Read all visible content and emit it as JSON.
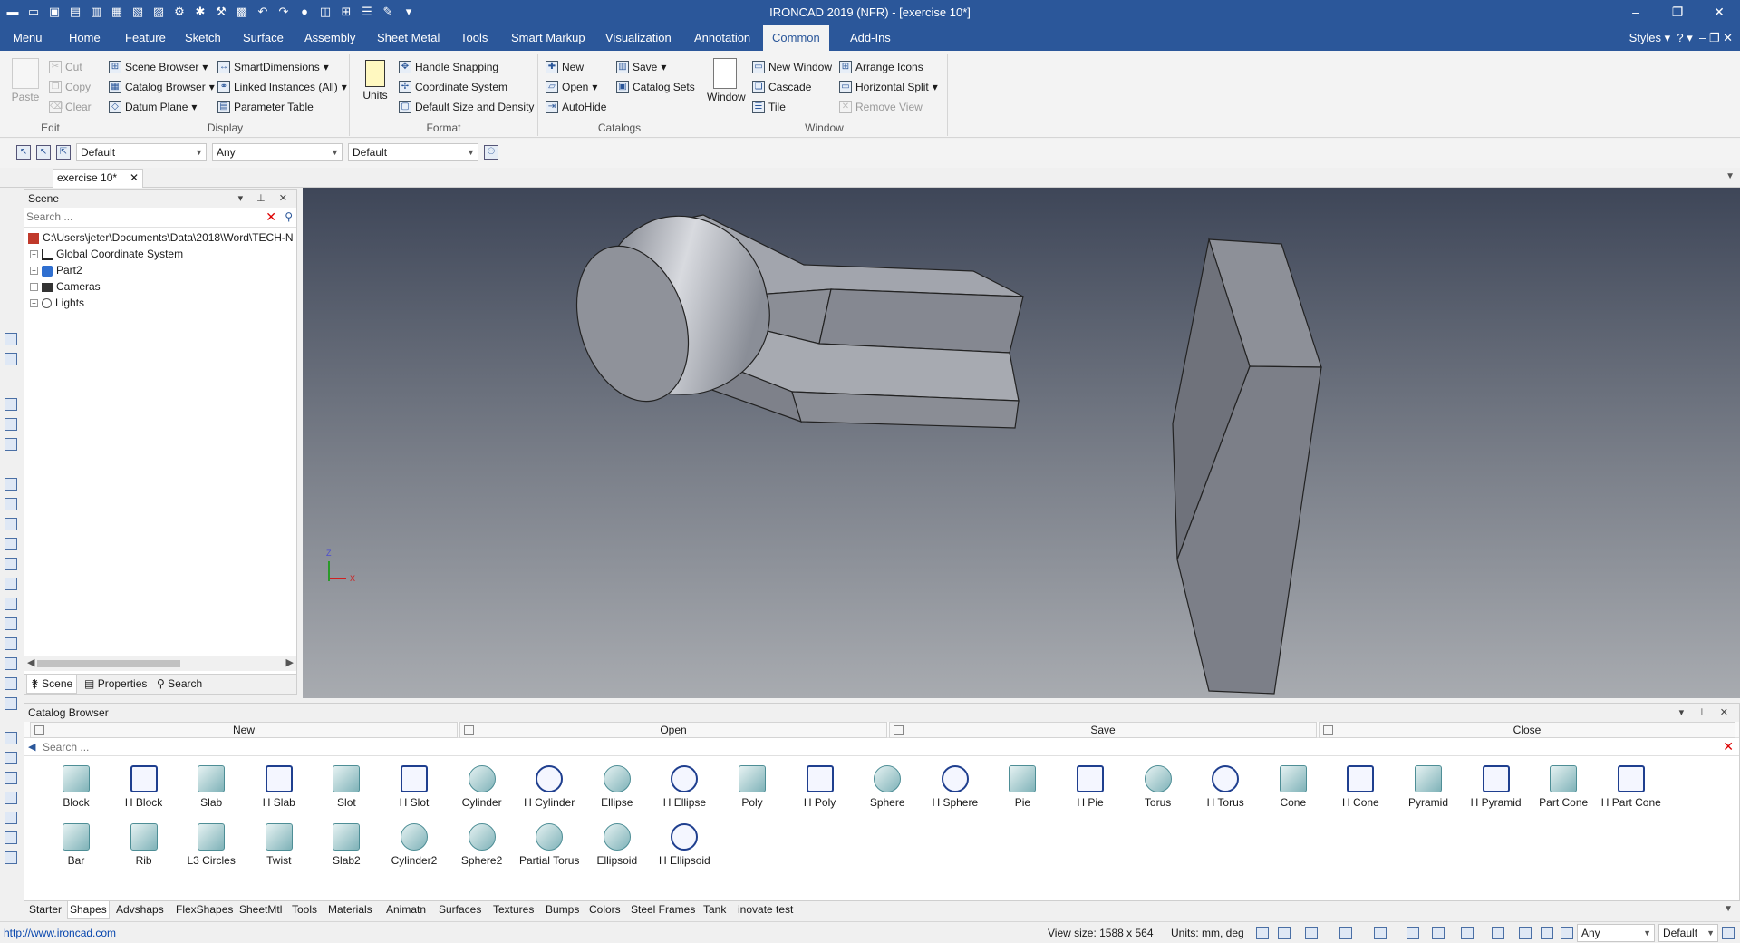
{
  "window": {
    "title": "IRONCAD 2019 (NFR) - [exercise 10*]",
    "controls": [
      "–",
      "❐",
      "✕"
    ]
  },
  "ribbon_tabs": [
    "Menu",
    "Home",
    "Feature",
    "Sketch",
    "Surface",
    "Assembly",
    "Sheet Metal",
    "Tools",
    "Smart Markup",
    "Visualization",
    "Annotation",
    "Common",
    "Add-Ins"
  ],
  "active_tab": "Common",
  "styles_label": "Styles",
  "ribbon": {
    "edit": {
      "label": "Edit",
      "paste": "Paste",
      "cut": "Cut",
      "copy": "Copy",
      "clear": "Clear"
    },
    "display": {
      "label": "Display",
      "scene_browser": "Scene Browser",
      "catalog_browser": "Catalog Browser",
      "datum_plane": "Datum Plane",
      "smart_dimensions": "SmartDimensions",
      "linked_instances": "Linked Instances (All)",
      "parameter_table": "Parameter Table"
    },
    "format": {
      "label": "Format",
      "units": "Units",
      "handle_snapping": "Handle Snapping",
      "coordinate_system": "Coordinate System",
      "default_size": "Default Size and Density"
    },
    "catalogs": {
      "label": "Catalogs",
      "new": "New",
      "open": "Open",
      "autohide": "AutoHide",
      "save": "Save",
      "catalog_sets": "Catalog Sets"
    },
    "window": {
      "label": "Window",
      "window": "Window",
      "new_window": "New Window",
      "cascade": "Cascade",
      "tile": "Tile",
      "arrange_icons": "Arrange Icons",
      "horizontal_split": "Horizontal Split",
      "remove_view": "Remove View"
    }
  },
  "toolbar": {
    "combo1": "Default",
    "combo2": "Any",
    "combo3": "Default"
  },
  "doc_tab": "exercise 10*",
  "scene": {
    "title": "Scene",
    "search_placeholder": "Search ...",
    "root": "C:\\Users\\jeter\\Documents\\Data\\2018\\Word\\TECH-N",
    "items": [
      "Global Coordinate System",
      "Part2",
      "Cameras",
      "Lights"
    ],
    "tabs": [
      "Scene",
      "Properties",
      "Search"
    ]
  },
  "axis": {
    "z": "Z",
    "x": "X"
  },
  "catalog": {
    "title": "Catalog Browser",
    "buttons": [
      "New",
      "Open",
      "Save",
      "Close"
    ],
    "search_placeholder": "Search ...",
    "shapes_row1": [
      "Block",
      "H Block",
      "Slab",
      "H Slab",
      "Slot",
      "H Slot",
      "Cylinder",
      "H Cylinder",
      "Ellipse",
      "H Ellipse",
      "Poly",
      "H Poly",
      "Sphere",
      "H Sphere",
      "Pie",
      "H Pie",
      "Torus",
      "H Torus",
      "Cone",
      "H Cone",
      "Pyramid",
      "H Pyramid",
      "Part Cone",
      "H Part Cone"
    ],
    "shapes_row2": [
      "Bar",
      "Rib",
      "L3 Circles",
      "Twist",
      "Slab2",
      "Cylinder2",
      "Sphere2",
      "Partial Torus",
      "Ellipsoid",
      "H Ellipsoid"
    ],
    "tabs": [
      "Starter",
      "Shapes",
      "Advshaps",
      "FlexShapes",
      "SheetMtl",
      "Tools",
      "Materials",
      "Animatn",
      "Surfaces",
      "Textures",
      "Bumps",
      "Colors",
      "Steel Frames",
      "Tank",
      "inovate test"
    ],
    "active_tab": "Shapes"
  },
  "status": {
    "link": "http://www.ironcad.com",
    "view_size": "View size: 1588 x  564",
    "units": "Units: mm, deg",
    "combo_any": "Any",
    "combo_default": "Default"
  }
}
